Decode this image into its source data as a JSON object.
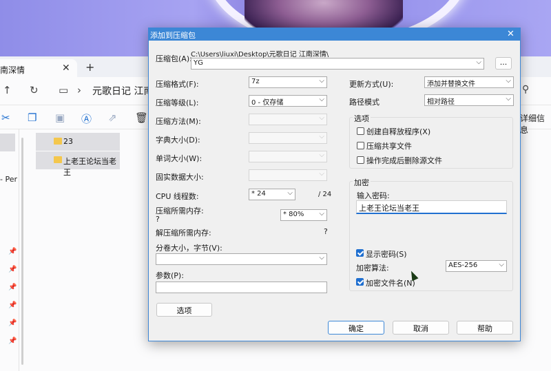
{
  "explorer": {
    "tab_label": "南深情",
    "tab_close": "✕",
    "new_tab": "+",
    "path_text": "元歌日记 江南深",
    "details_label": "详细信息",
    "sidebar_text": "- Per",
    "folders": [
      {
        "name": "23"
      },
      {
        "name": "上老王论坛当老王"
      }
    ]
  },
  "dialog": {
    "title": "添加到压缩包",
    "close": "✕",
    "archive_label": "压缩包(A):",
    "archive_dir": "C:\\Users\\liuxi\\Desktop\\元歌日记 江南深情\\",
    "archive_name": "YG",
    "browse_label": "...",
    "format_label": "压缩格式(F):",
    "format_value": "7z",
    "level_label": "压缩等级(L):",
    "level_value": "0 - 仅存储",
    "method_label": "压缩方法(M):",
    "dict_label": "字典大小(D):",
    "word_label": "单词大小(W):",
    "solid_label": "固实数据大小:",
    "threads_label": "CPU 线程数:",
    "threads_value": "* 24",
    "threads_total": "/ 24",
    "mem_comp_label": "压缩所需内存:",
    "mem_comp_q": "?",
    "mem_comp_value": "* 80%",
    "mem_decomp_label": "解压缩所需内存:",
    "mem_decomp_q": "?",
    "split_label": "分卷大小，字节(V):",
    "params_label": "参数(P):",
    "options_button": "选项",
    "update_label": "更新方式(U):",
    "update_value": "添加并替换文件",
    "path_label": "路径模式",
    "path_value": "相对路径",
    "options_group": "选项",
    "opt_sfx": "创建自释放程序(X)",
    "opt_shared": "压缩共享文件",
    "opt_delete": "操作完成后删除源文件",
    "encrypt_group": "加密",
    "password_label": "输入密码:",
    "password_value": "上老王论坛当老王",
    "show_password": "显示密码(S)",
    "algo_label": "加密算法:",
    "algo_value": "AES-256",
    "encrypt_names": "加密文件名(N)",
    "ok_button": "确定",
    "cancel_button": "取消",
    "help_button": "帮助"
  },
  "icons": {
    "back": "back-arrow-icon",
    "refresh": "refresh-icon",
    "monitor": "monitor-icon",
    "chevron": "chevron-right-icon",
    "dropdown": "chevron-down-icon",
    "cut": "cut-icon",
    "copy": "copy-icon",
    "paste": "paste-icon",
    "rename": "rename-icon",
    "share": "share-icon",
    "delete": "delete-icon",
    "pin": "pin-icon",
    "search": "search-icon",
    "folder": "folder-icon"
  },
  "colors": {
    "accent": "#3c87d6",
    "dialog_bg": "#f0f0f0",
    "checkbox_checked": "#1f6fd0",
    "folder": "#f4c74d"
  }
}
